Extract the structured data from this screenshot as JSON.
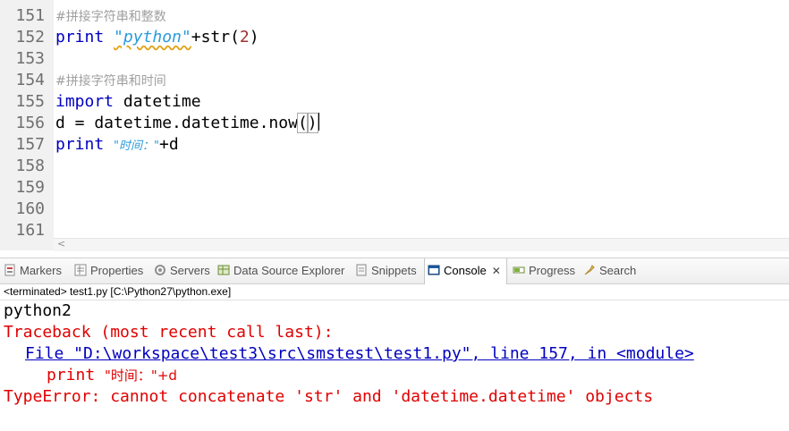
{
  "editor": {
    "lines": [
      {
        "n": "151",
        "comment": "#拼接字符串和整数"
      },
      {
        "n": "152",
        "kw": "print",
        "str": "\"python\"",
        "rest1": "+str(",
        "num": "2",
        "rest2": ")"
      },
      {
        "n": "153"
      },
      {
        "n": "154",
        "comment": "#拼接字符串和时间"
      },
      {
        "n": "155",
        "kw": "import",
        "rest": " datetime"
      },
      {
        "n": "156",
        "code": "d = datetime.datetime.now",
        "bracket_open": "(",
        "bracket_close": ")"
      },
      {
        "n": "157",
        "kw": "print",
        "str": "\"时间：\"",
        "rest": "+d"
      },
      {
        "n": "158"
      },
      {
        "n": "159"
      },
      {
        "n": "160"
      },
      {
        "n": "161"
      }
    ],
    "scroll_left_arrow": "<"
  },
  "tabs": [
    {
      "label": "Markers",
      "icon": "markers-icon"
    },
    {
      "label": "Properties",
      "icon": "properties-icon"
    },
    {
      "label": "Servers",
      "icon": "servers-icon"
    },
    {
      "label": "Data Source Explorer",
      "icon": "data-source-icon"
    },
    {
      "label": "Snippets",
      "icon": "snippets-icon"
    },
    {
      "label": "Console",
      "icon": "console-icon",
      "active": true,
      "close": "✕"
    },
    {
      "label": "Progress",
      "icon": "progress-icon"
    },
    {
      "label": "Search",
      "icon": "search-icon"
    }
  ],
  "console": {
    "header": "<terminated> test1.py [C:\\Python27\\python.exe]",
    "output": "python2",
    "traceback": "Traceback (most recent call last):",
    "file_line": "File \"D:\\workspace\\test3\\src\\smstest\\test1.py\", line 157, in <module>",
    "code_kw": "print ",
    "code_str": "\"时间：\"",
    "code_rest": "+d",
    "error": "TypeError: cannot concatenate 'str' and 'datetime.datetime' objects"
  },
  "colors": {
    "keyword": "#0000c0",
    "string": "#2a9bdc",
    "error": "#e00000",
    "link": "#0000c0"
  }
}
